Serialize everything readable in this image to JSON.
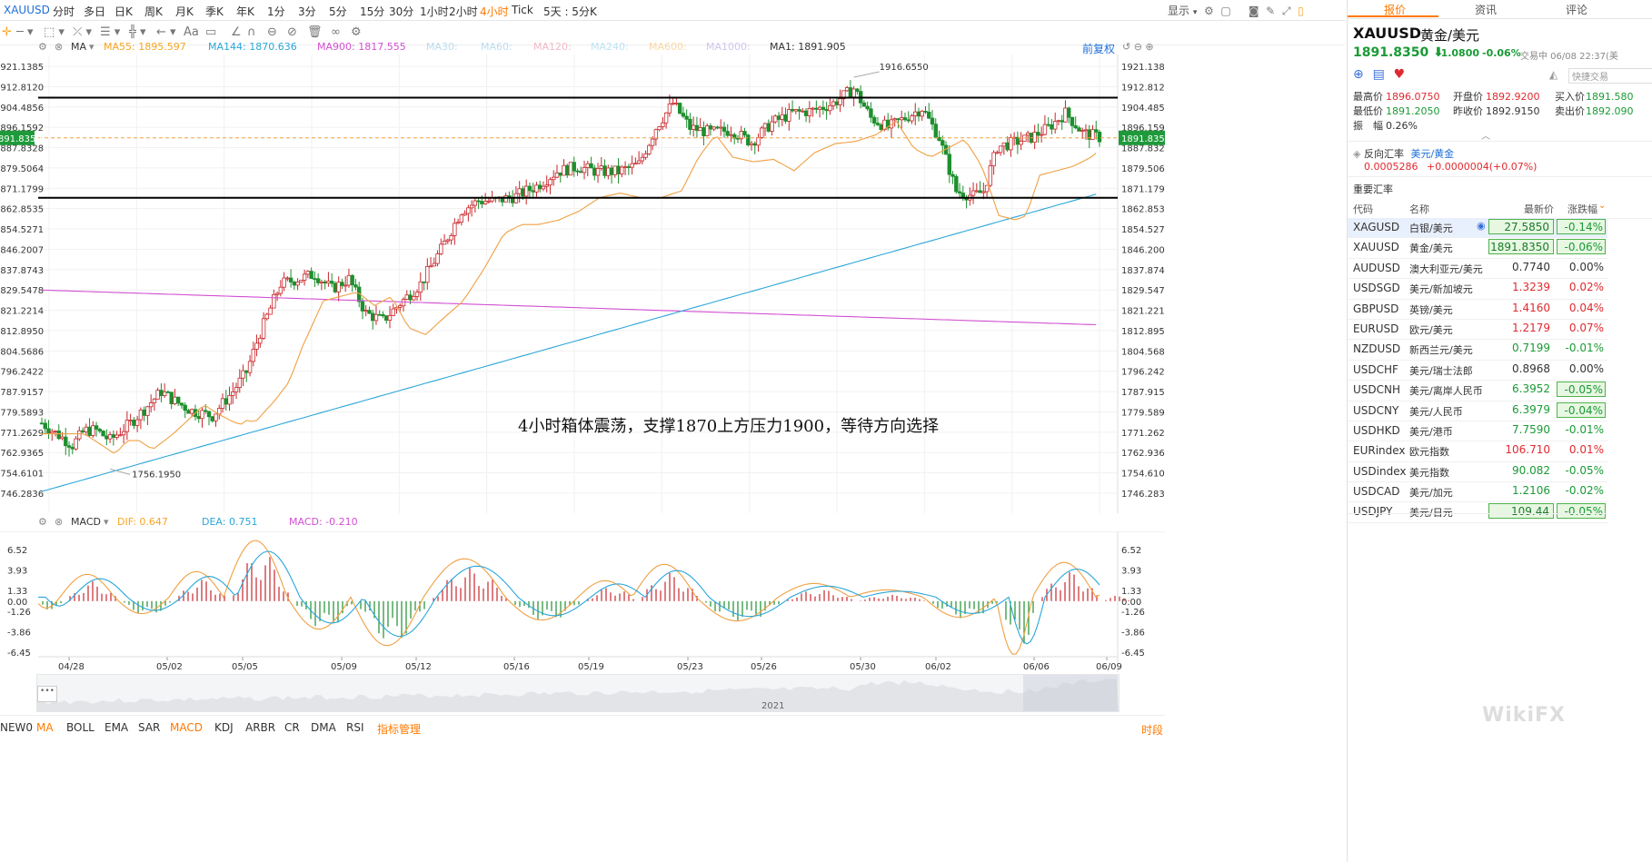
{
  "symbol": "XAUUSD",
  "periods": [
    "分时",
    "多日",
    "日K",
    "周K",
    "月K",
    "季K",
    "年K",
    "1分",
    "3分",
    "5分",
    "15分",
    "30分",
    "1小时",
    "2小时",
    "4小时",
    "Tick",
    "5天 : 5分K"
  ],
  "active_period": "4小时",
  "top_right": {
    "display": "显示"
  },
  "main_legend": {
    "ma_label": "MA",
    "ma55": "MA55: 1895.597",
    "ma144": "MA144: 1870.636",
    "ma900": "MA900: 1817.555",
    "ma30": "MA30:",
    "ma60": "MA60:",
    "ma120": "MA120:",
    "ma240": "MA240:",
    "ma600": "MA600:",
    "ma1000": "MA1000:",
    "ma1": "MA1: 1891.905",
    "adjust": "前复权"
  },
  "price_axis": [
    "1921.1385",
    "1912.8120",
    "1904.4856",
    "1896.1592",
    "1887.8328",
    "1879.5064",
    "1871.1799",
    "1862.8535",
    "1854.5271",
    "1846.2007",
    "1837.8743",
    "1829.5478",
    "1821.2214",
    "1812.8950",
    "1804.5686",
    "1796.2422",
    "1787.9157",
    "1779.5893",
    "1771.2629",
    "1762.9365",
    "1754.6101",
    "1746.2836"
  ],
  "last_price_tag": "1891.8350",
  "last_price_tag_left": "891.8350",
  "high_label": "1916.6550",
  "low_label": "1756.1950",
  "annotation": "4小时箱体震荡，支撑1870上方压力1900，等待方向选择",
  "macd_legend": {
    "name": "MACD",
    "dif": "DIF: 0.647",
    "dea": "DEA: 0.751",
    "macd": "MACD: -0.210"
  },
  "macd_axis": [
    "6.52",
    "3.93",
    "1.33",
    "0.00",
    "-1.26",
    "-3.86",
    "-6.45"
  ],
  "date_axis": [
    "04/28",
    "05/02",
    "05/05",
    "05/09",
    "05/12",
    "05/16",
    "05/19",
    "05/23",
    "05/26",
    "05/30",
    "06/02",
    "06/06",
    "06/09"
  ],
  "navigator_year": "2021",
  "indicators": [
    "NEW0",
    "MA",
    "BOLL",
    "EMA",
    "SAR",
    "MACD",
    "KDJ",
    "ARBR",
    "CR",
    "DMA",
    "RSI",
    "指标管理"
  ],
  "bottom_right": "时段",
  "right_panel": {
    "tabs": [
      "报价",
      "资讯",
      "评论"
    ],
    "symbol": "XAUUSD",
    "name": "黄金/美元",
    "price": "1891.8350",
    "change": "-1.0800",
    "change_pct": "-0.06%",
    "trade_time": "交易中 06/08 22:37(美",
    "quick_trade": "快捷交易",
    "stats": {
      "high_label": "最高价",
      "high": "1896.0750",
      "open_label": "开盘价",
      "open": "1892.9200",
      "bid_label": "买入价",
      "bid": "1891.580",
      "low_label": "最低价",
      "low": "1891.2050",
      "prev_label": "昨收价",
      "prev": "1892.9150",
      "ask_label": "卖出价",
      "ask": "1892.090",
      "amp_label": "振　幅",
      "amp": "0.26%"
    },
    "reverse": {
      "label": "反向汇率",
      "pair": "美元/黄金",
      "value": "0.0005286",
      "change": "+0.0000004(+0.07%)"
    },
    "section_title": "重要汇率",
    "table_headers": [
      "代码",
      "名称",
      "最新价",
      "涨跌幅"
    ],
    "rows": [
      {
        "code": "XAGUSD",
        "name": "白银/美元",
        "price": "27.5850",
        "pct": "-0.14%",
        "dir": "up",
        "pdir": "down"
      },
      {
        "code": "XAUUSD",
        "name": "黄金/美元",
        "price": "1891.8350",
        "pct": "-0.06%",
        "dir": "up",
        "pdir": "down"
      },
      {
        "code": "AUDUSD",
        "name": "澳大利亚元/美元",
        "price": "0.7740",
        "pct": "0.00%",
        "dir": "flat",
        "pdir": "flat"
      },
      {
        "code": "USDSGD",
        "name": "美元/新加坡元",
        "price": "1.3239",
        "pct": "0.02%",
        "dir": "up",
        "pdir": "up"
      },
      {
        "code": "GBPUSD",
        "name": "英镑/美元",
        "price": "1.4160",
        "pct": "0.04%",
        "dir": "up",
        "pdir": "up"
      },
      {
        "code": "EURUSD",
        "name": "欧元/美元",
        "price": "1.2179",
        "pct": "0.07%",
        "dir": "up",
        "pdir": "up"
      },
      {
        "code": "NZDUSD",
        "name": "新西兰元/美元",
        "price": "0.7199",
        "pct": "-0.01%",
        "dir": "down",
        "pdir": "down"
      },
      {
        "code": "USDCHF",
        "name": "美元/瑞士法郎",
        "price": "0.8968",
        "pct": "0.00%",
        "dir": "flat",
        "pdir": "flat"
      },
      {
        "code": "USDCNH",
        "name": "美元/离岸人民币",
        "price": "6.3952",
        "pct": "-0.05%",
        "dir": "down",
        "pdir": "down"
      },
      {
        "code": "USDCNY",
        "name": "美元/人民币",
        "price": "6.3979",
        "pct": "-0.04%",
        "dir": "down",
        "pdir": "down"
      },
      {
        "code": "USDHKD",
        "name": "美元/港币",
        "price": "7.7590",
        "pct": "-0.01%",
        "dir": "down",
        "pdir": "down"
      },
      {
        "code": "EURindex",
        "name": "欧元指数",
        "price": "106.710",
        "pct": "0.01%",
        "dir": "up",
        "pdir": "up"
      },
      {
        "code": "USDindex",
        "name": "美元指数",
        "price": "90.082",
        "pct": "-0.05%",
        "dir": "down",
        "pdir": "down"
      },
      {
        "code": "USDCAD",
        "name": "美元/加元",
        "price": "1.2106",
        "pct": "-0.02%",
        "dir": "down",
        "pdir": "down"
      },
      {
        "code": "USDJPY",
        "name": "美元/日元",
        "price": "109.44",
        "pct": "-0.05%",
        "dir": "down",
        "pdir": "down"
      }
    ]
  },
  "watermark": "WikiFX"
}
